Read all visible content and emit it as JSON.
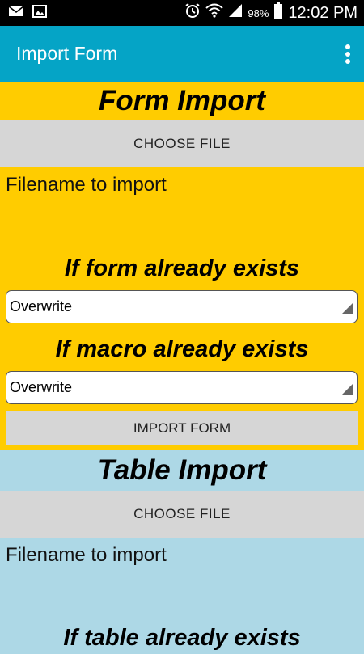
{
  "status": {
    "battery_percent": "98%",
    "time": "12:02 PM",
    "icons": [
      "mail-icon",
      "image-icon",
      "alarm-icon",
      "wifi-icon",
      "signal-icon",
      "battery-icon"
    ]
  },
  "appbar": {
    "title": "Import Form",
    "menu_icon": "overflow-menu-icon"
  },
  "form_import": {
    "heading": "Form Import",
    "choose_file_label": "CHOOSE FILE",
    "filename_label": "Filename to import",
    "form_exists_heading": "If form already exists",
    "form_exists_value": "Overwrite",
    "macro_exists_heading": "If macro already exists",
    "macro_exists_value": "Overwrite",
    "import_button_label": "IMPORT FORM"
  },
  "table_import": {
    "heading": "Table Import",
    "choose_file_label": "CHOOSE FILE",
    "filename_label": "Filename to import",
    "table_exists_heading": "If table already exists"
  },
  "colors": {
    "appbar": "#05a4c6",
    "form_section": "#ffcc00",
    "table_section": "#add8e6",
    "button": "#d6d6d6"
  }
}
